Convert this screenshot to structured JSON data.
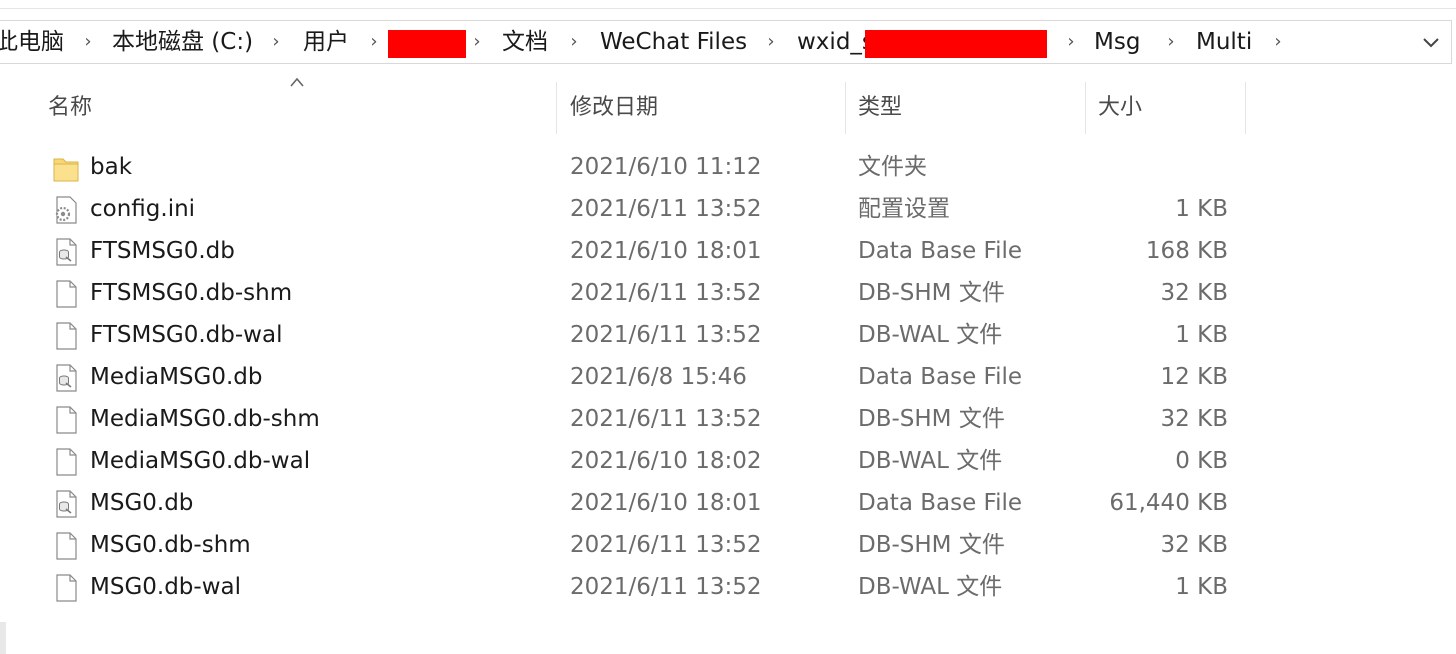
{
  "breadcrumb": {
    "items": [
      "此电脑",
      "本地磁盘 (C:)",
      "用户",
      "文档",
      "WeChat Files",
      "wxid_s",
      "Msg",
      "Multi"
    ],
    "separator": "›"
  },
  "columns": {
    "name": "名称",
    "modified": "修改日期",
    "type": "类型",
    "size": "大小",
    "sort_column": "name",
    "sort_direction": "ascending"
  },
  "files": [
    {
      "name": "bak",
      "modified": "2021/6/10 11:12",
      "type": "文件夹",
      "size": "",
      "icon": "folder-icon"
    },
    {
      "name": "config.ini",
      "modified": "2021/6/11 13:52",
      "type": "配置设置",
      "size": "1 KB",
      "icon": "settings-file-icon"
    },
    {
      "name": "FTSMSG0.db",
      "modified": "2021/6/10 18:01",
      "type": "Data Base File",
      "size": "168 KB",
      "icon": "database-file-icon"
    },
    {
      "name": "FTSMSG0.db-shm",
      "modified": "2021/6/11 13:52",
      "type": "DB-SHM 文件",
      "size": "32 KB",
      "icon": "blank-file-icon"
    },
    {
      "name": "FTSMSG0.db-wal",
      "modified": "2021/6/11 13:52",
      "type": "DB-WAL 文件",
      "size": "1 KB",
      "icon": "blank-file-icon"
    },
    {
      "name": "MediaMSG0.db",
      "modified": "2021/6/8 15:46",
      "type": "Data Base File",
      "size": "12 KB",
      "icon": "database-file-icon"
    },
    {
      "name": "MediaMSG0.db-shm",
      "modified": "2021/6/11 13:52",
      "type": "DB-SHM 文件",
      "size": "32 KB",
      "icon": "blank-file-icon"
    },
    {
      "name": "MediaMSG0.db-wal",
      "modified": "2021/6/10 18:02",
      "type": "DB-WAL 文件",
      "size": "0 KB",
      "icon": "blank-file-icon"
    },
    {
      "name": "MSG0.db",
      "modified": "2021/6/10 18:01",
      "type": "Data Base File",
      "size": "61,440 KB",
      "icon": "database-file-icon"
    },
    {
      "name": "MSG0.db-shm",
      "modified": "2021/6/11 13:52",
      "type": "DB-SHM 文件",
      "size": "32 KB",
      "icon": "blank-file-icon"
    },
    {
      "name": "MSG0.db-wal",
      "modified": "2021/6/11 13:52",
      "type": "DB-WAL 文件",
      "size": "1 KB",
      "icon": "blank-file-icon"
    }
  ],
  "colors": {
    "redaction": "#ff0000",
    "folder": "#f8d775",
    "text_primary": "#1a1a1a",
    "text_secondary": "#6b6b6b"
  }
}
